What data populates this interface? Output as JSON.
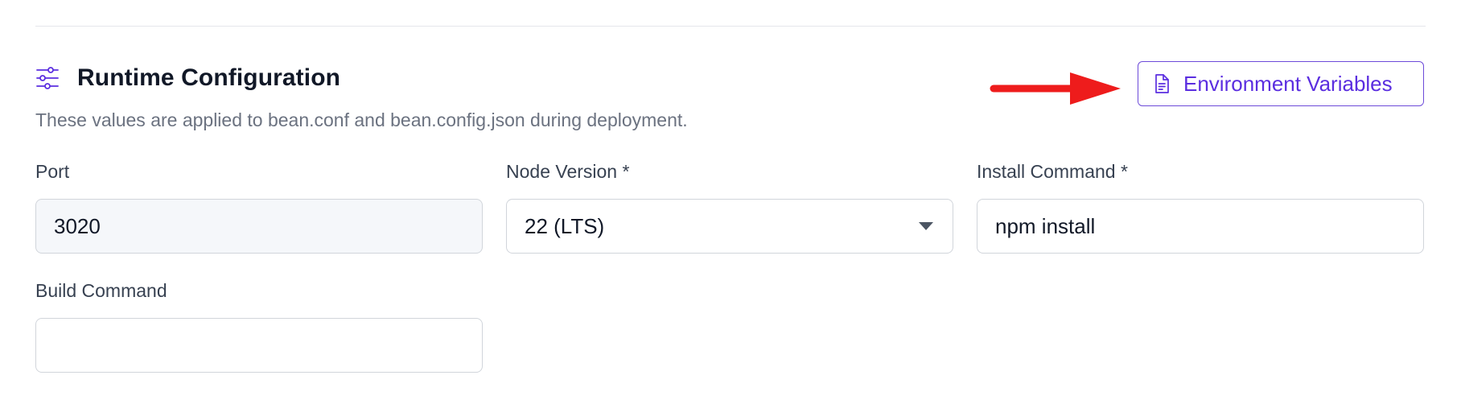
{
  "section": {
    "title": "Runtime Configuration",
    "icon": "sliders-icon",
    "description": "These values are applied to bean.conf and bean.config.json during deployment."
  },
  "env_button": {
    "label": "Environment Variables",
    "icon": "document-icon"
  },
  "annotation": {
    "arrow_color": "#ee1c1c"
  },
  "fields": {
    "port": {
      "label": "Port",
      "value": "3020"
    },
    "node_version": {
      "label": "Node Version *",
      "selected": "22 (LTS)"
    },
    "install_command": {
      "label": "Install Command *",
      "value": "npm install"
    },
    "build_command": {
      "label": "Build Command",
      "value": ""
    }
  },
  "colors": {
    "accent": "#5b2ee0",
    "accent_border": "#6d4bd9",
    "readonly_bg": "#f5f7fa",
    "border": "#d1d5db",
    "muted_text": "#6b7280"
  }
}
